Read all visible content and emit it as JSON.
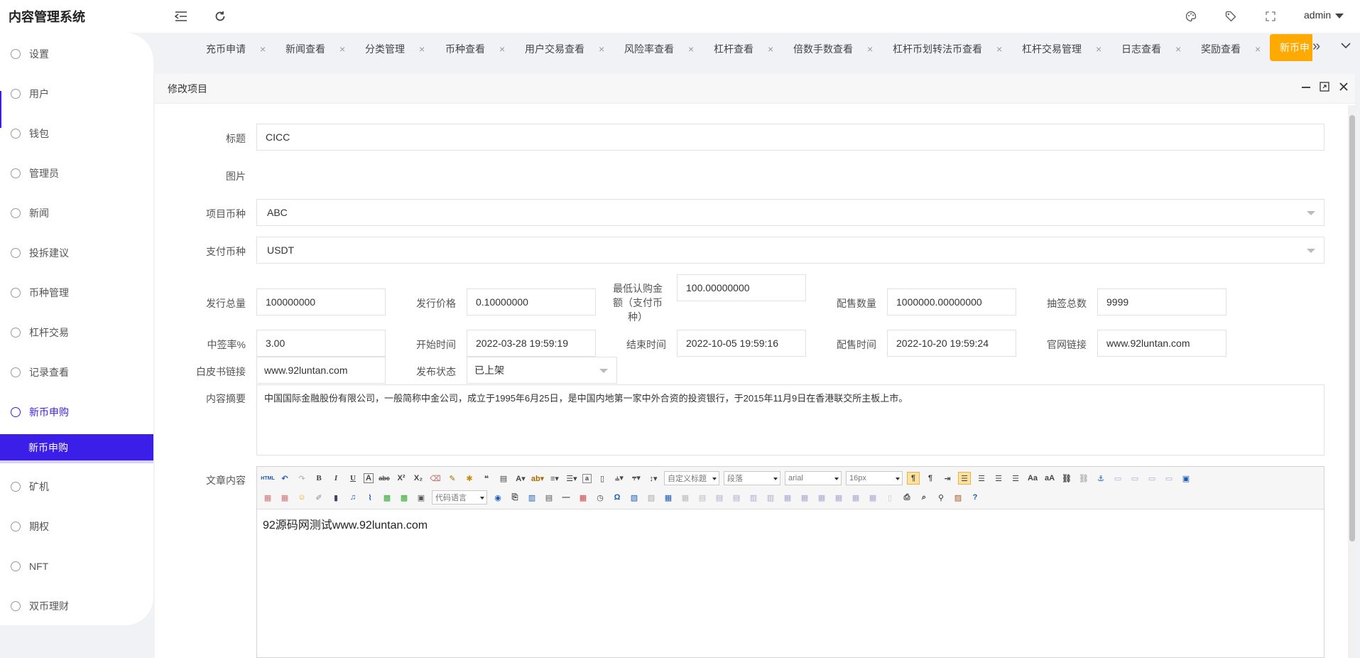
{
  "app": {
    "title": "内容管理系统",
    "user": "admin"
  },
  "sidebar": {
    "items": [
      {
        "label": "设置",
        "icon": "gear-icon"
      },
      {
        "label": "用户",
        "icon": "user-icon"
      },
      {
        "label": "钱包",
        "icon": "wallet-icon"
      },
      {
        "label": "管理员",
        "icon": "shield-icon"
      },
      {
        "label": "新闻",
        "icon": "tag-icon"
      },
      {
        "label": "投拆建议",
        "icon": "link-icon"
      },
      {
        "label": "币种管理",
        "icon": "diamond-icon"
      },
      {
        "label": "杠杆交易",
        "icon": "diamond-icon"
      },
      {
        "label": "记录查看",
        "icon": "circle-arrow-icon"
      },
      {
        "label": "新币申购",
        "icon": "dollar-icon"
      },
      {
        "label": "矿机",
        "icon": "circle-arrow-icon"
      },
      {
        "label": "期权",
        "icon": "circle-arrow-icon"
      },
      {
        "label": "NFT",
        "icon": "circle-arrow-icon"
      },
      {
        "label": "双币理财",
        "icon": "circle-arrow-icon"
      }
    ],
    "sub_active": "新币申购"
  },
  "tabs": [
    {
      "label": "充币申请"
    },
    {
      "label": "新闻查看"
    },
    {
      "label": "分类管理"
    },
    {
      "label": "币种查看"
    },
    {
      "label": "用户交易查看"
    },
    {
      "label": "风险率查看"
    },
    {
      "label": "杠杆查看"
    },
    {
      "label": "倍数手数查看"
    },
    {
      "label": "杠杆币划转法币查看"
    },
    {
      "label": "杠杆交易管理"
    },
    {
      "label": "日志查看"
    },
    {
      "label": "奖励查看"
    }
  ],
  "active_tab": "新币申",
  "panel": {
    "title": "修改项目"
  },
  "form": {
    "title": {
      "label": "标题",
      "value": "CICC"
    },
    "image": {
      "label": "图片"
    },
    "project_coin": {
      "label": "项目币种",
      "value": "ABC"
    },
    "pay_coin": {
      "label": "支付币种",
      "value": "USDT"
    },
    "total_issue": {
      "label": "发行总量",
      "value": "100000000"
    },
    "issue_price": {
      "label": "发行价格",
      "value": "0.10000000"
    },
    "min_amount": {
      "label_l1": "最低认购金",
      "label_l2": "额（支付币",
      "label_l3": "种）",
      "value": "100.00000000"
    },
    "allot_qty": {
      "label": "配售数量",
      "value": "1000000.00000000"
    },
    "lottery_total": {
      "label": "抽签总数",
      "value": "9999"
    },
    "win_rate": {
      "label": "中签率%",
      "value": "3.00"
    },
    "start_time": {
      "label": "开始时间",
      "value": "2022-03-28 19:59:19"
    },
    "end_time": {
      "label": "结束时间",
      "value": "2022-10-05 19:59:16"
    },
    "allot_time": {
      "label": "配售时间",
      "value": "2022-10-20 19:59:24"
    },
    "website": {
      "label": "官网链接",
      "value": "www.92luntan.com"
    },
    "whitepaper": {
      "label": "白皮书链接",
      "value": "www.92luntan.com"
    },
    "status": {
      "label": "发布状态",
      "value": "已上架"
    },
    "summary": {
      "label": "内容摘要",
      "value": "中国国际金融股份有限公司，一般简称中金公司，成立于1995年6月25日，是中国内地第一家中外合资的投资银行，于2015年11月9日在香港联交所主板上市。"
    },
    "content": {
      "label": "文章内容",
      "value": "92源码网测试www.92luntan.com"
    }
  },
  "editor": {
    "custom_title": "自定义标题",
    "paragraph": "段落",
    "font": "arial",
    "size": "16px",
    "code_lang": "代码语言"
  },
  "colors": {
    "accent": "#3b1fe8",
    "active_tab": "#ffaa00"
  }
}
